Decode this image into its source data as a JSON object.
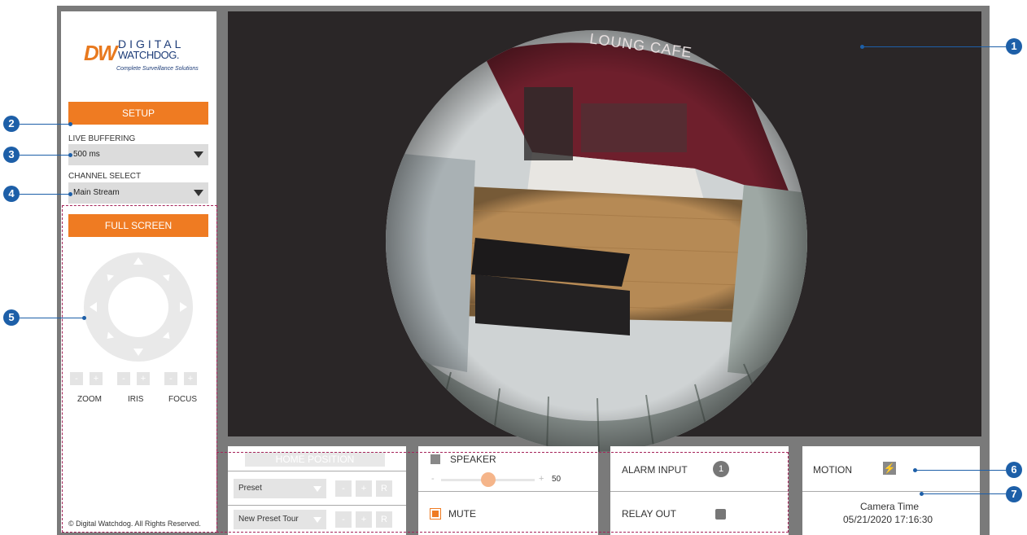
{
  "logo": {
    "brand_line1": "DIGITAL",
    "brand_line2": "WATCHDOG.",
    "brand_mark": "DW",
    "tagline": "Complete Surveillance Solutions"
  },
  "sidebar": {
    "setup_label": "SETUP",
    "live_buffering_label": "LIVE BUFFERING",
    "live_buffering_value": "500 ms",
    "channel_select_label": "CHANNEL SELECT",
    "channel_select_value": "Main Stream",
    "full_screen_label": "FULL SCREEN",
    "ptz_minus": "-",
    "ptz_plus": "+",
    "zoom_label": "ZOOM",
    "iris_label": "IRIS",
    "focus_label": "FOCUS",
    "copyright": "© Digital Watchdog. All Rights Reserved."
  },
  "video": {
    "sign_text": "LOUNG CAFE"
  },
  "preset_panel": {
    "home_position_label": "HOME POSITION",
    "preset_value": "Preset",
    "preset_tour_value": "New Preset Tour",
    "minus": "-",
    "plus": "+",
    "r": "R"
  },
  "audio_panel": {
    "speaker_label": "SPEAKER",
    "slider_minus": "-",
    "slider_plus": "+",
    "speaker_volume": "50",
    "speaker_volume_level": 0.5,
    "mute_label": "MUTE"
  },
  "io_panel": {
    "alarm_input_label": "ALARM INPUT",
    "alarm_input_badge": "1",
    "relay_out_label": "RELAY OUT"
  },
  "status_panel": {
    "motion_label": "MOTION",
    "camera_time_label": "Camera Time",
    "camera_time_value": "05/21/2020 17:16:30"
  },
  "callouts": [
    "1",
    "2",
    "3",
    "4",
    "5",
    "6",
    "7"
  ],
  "colors": {
    "accent_orange": "#ef7b22",
    "callout_blue": "#1d5fa8",
    "dashed_magenta": "#a6245a",
    "brand_navy": "#1d3c78"
  }
}
